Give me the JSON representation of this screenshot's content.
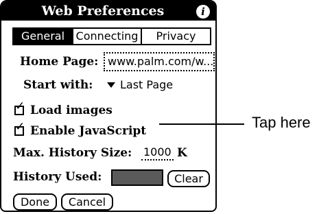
{
  "window": {
    "title": "Web Preferences",
    "info_icon_glyph": "i",
    "info_icon": "info-icon"
  },
  "tabs": [
    {
      "label": "General",
      "selected": true
    },
    {
      "label": "Connecting",
      "selected": false
    },
    {
      "label": "Privacy",
      "selected": false
    }
  ],
  "home_page": {
    "label": "Home Page:",
    "value": "www.palm.com/w..."
  },
  "start_with": {
    "label": "Start with:",
    "value": "Last Page",
    "icon": "dropdown-arrow-icon"
  },
  "options": {
    "load_images": {
      "label": "Load images",
      "checked": true,
      "check_glyph": "✓"
    },
    "enable_javascript": {
      "label": "Enable JavaScript",
      "checked": true,
      "check_glyph": "✓"
    }
  },
  "max_history": {
    "label": "Max. History Size:",
    "value": "1000",
    "unit": "K"
  },
  "history_used": {
    "label": "History Used:",
    "fill_fraction": 1.0,
    "fill_color": "#5a5a5a"
  },
  "buttons": {
    "clear": "Clear",
    "done": "Done",
    "cancel": "Cancel"
  },
  "callout": {
    "text": "Tap here"
  },
  "colors": {
    "title_bar": "#000000",
    "selected_tab": "#000000",
    "background": "#ffffff"
  }
}
